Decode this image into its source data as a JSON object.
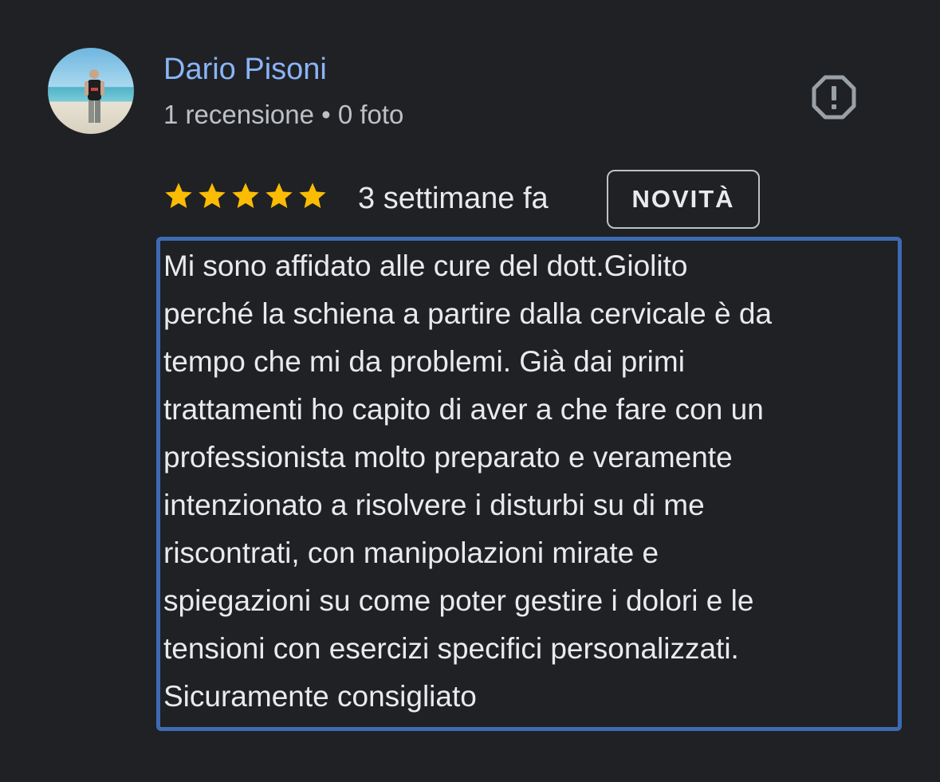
{
  "review": {
    "author": {
      "name": "Dario Pisoni",
      "meta": "1 recensione • 0 foto",
      "avatar_icon": "avatar-photo"
    },
    "report_icon": "report-octagon-icon",
    "rating": 5,
    "rating_max": 5,
    "date": "3 settimane fa",
    "badge": "NOVITÀ",
    "text_lines": [
      "Mi sono affidato alle cure del dott.Giolito",
      "perché la schiena a partire dalla cervicale è da",
      "tempo che mi da problemi. Già dai primi",
      "trattamenti ho capito di aver a che fare con un",
      "professionista molto preparato e veramente",
      "intenzionato a risolvere i disturbi su di me",
      "riscontrati, con manipolazioni mirate e",
      "spiegazioni su come poter gestire i dolori e le",
      "tensioni con esercizi specifici personalizzati.",
      "Sicuramente consigliato"
    ]
  },
  "colors": {
    "background": "#202124",
    "author_name": "#8ab4f8",
    "star": "#fbbc04",
    "highlight_border": "#3d6bb3"
  }
}
